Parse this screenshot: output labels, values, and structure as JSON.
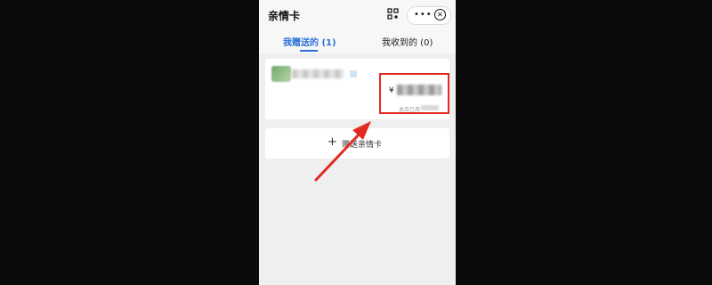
{
  "header": {
    "title": "亲情卡",
    "more_icon": "•••",
    "close_icon": "✕"
  },
  "tabs": [
    {
      "label": "我赠送的 (1)",
      "active": true
    },
    {
      "label": "我收到的 (0)",
      "active": false
    }
  ],
  "card": {
    "currency": "¥",
    "used_label": "本月已用"
  },
  "give_button": {
    "icon": "+",
    "label": "赠送亲情卡"
  },
  "colors": {
    "accent": "#2a6fd6",
    "highlight": "#e02b21"
  }
}
